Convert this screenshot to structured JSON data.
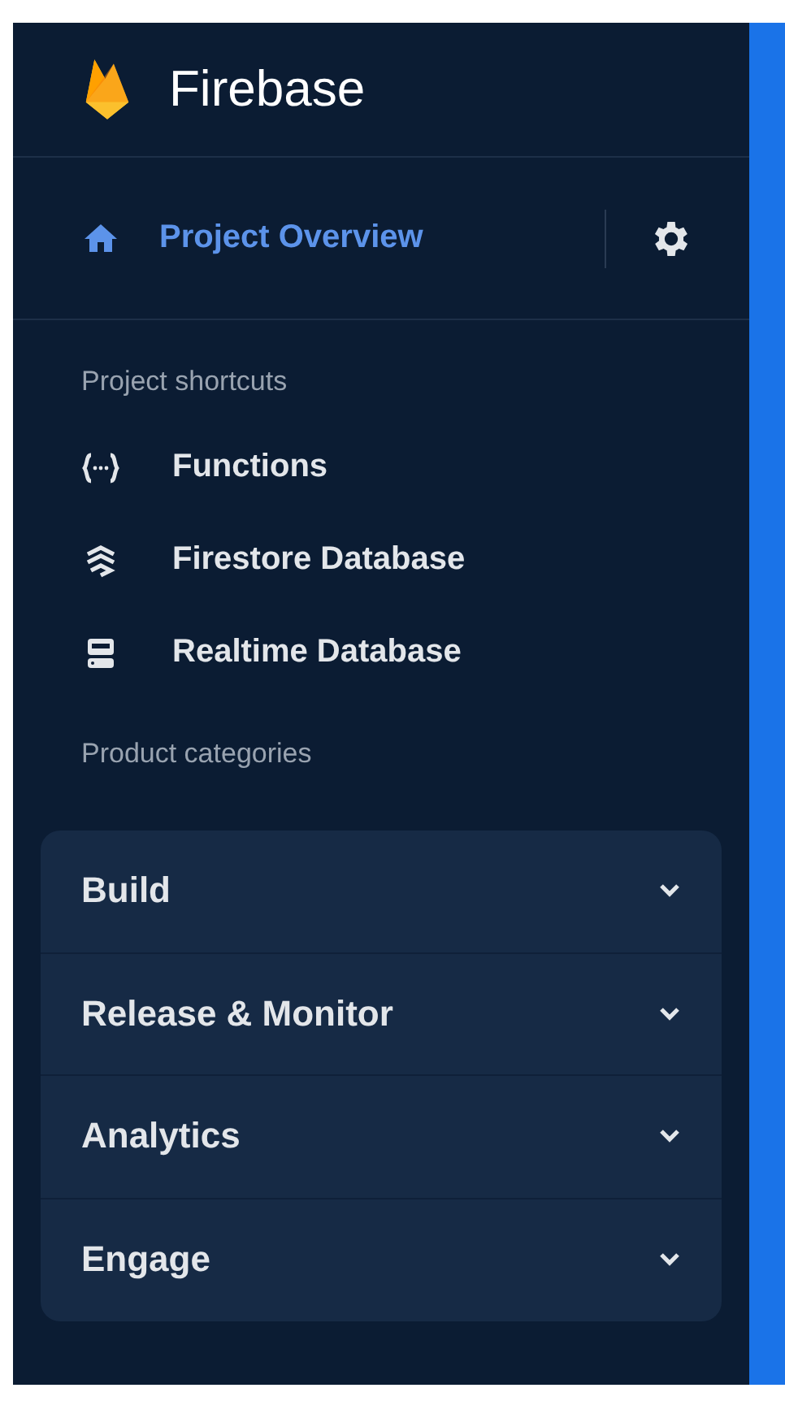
{
  "brand": {
    "title": "Firebase"
  },
  "overview": {
    "label": "Project Overview",
    "selected": true
  },
  "shortcuts": {
    "heading": "Project shortcuts",
    "items": [
      {
        "label": "Functions",
        "kind": "functions",
        "selected": false
      },
      {
        "label": "Firestore Database",
        "kind": "firestore",
        "selected": false
      },
      {
        "label": "Realtime Database",
        "kind": "realtime",
        "selected": false
      }
    ]
  },
  "categories": {
    "heading": "Product categories",
    "items": [
      {
        "label": "Build",
        "expanded": false
      },
      {
        "label": "Release & Monitor",
        "expanded": false
      },
      {
        "label": "Analytics",
        "expanded": false
      },
      {
        "label": "Engage",
        "expanded": false
      }
    ]
  }
}
